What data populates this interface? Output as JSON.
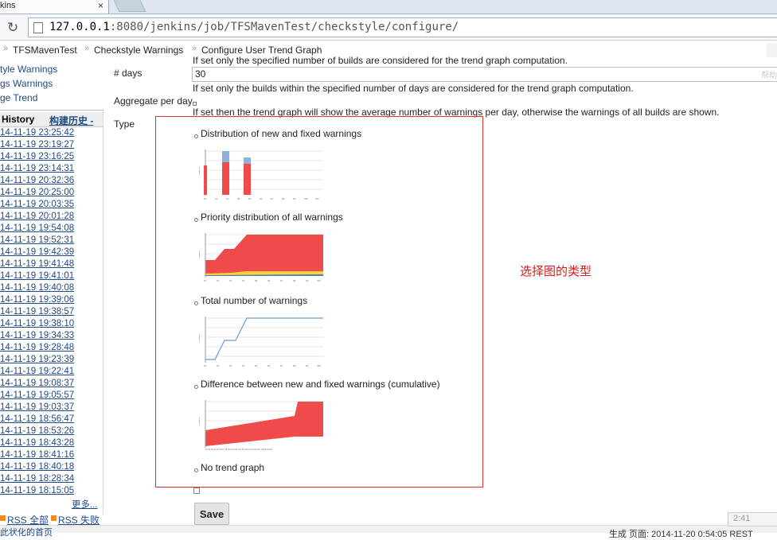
{
  "browser": {
    "tab_title": "kins",
    "tab_close": "×",
    "url_host": "127.0.0.1",
    "url_rest": ":8080/jenkins/job/TFSMavenTest/checkstyle/configure/"
  },
  "breadcrumb": [
    "TFSMavenTest",
    "Checkstyle Warnings",
    "Configure User Trend Graph"
  ],
  "sidebar": {
    "links": [
      "tyle Warnings",
      "gs Warnings",
      "ge Trend"
    ],
    "history_title": "History",
    "history_cn": "构建历史 -",
    "history_rows": [
      "14-11-19 23:25:42",
      "14-11-19 23:19:27",
      "14-11-19 23:16:25",
      "14-11-19 23:14:31",
      "14-11-19 20:32:36",
      "14-11-19 20:25:00",
      "14-11-19 20:03:35",
      "14-11-19 20:01:28",
      "14-11-19 19:54:08",
      "14-11-19 19:52:31",
      "14-11-19 19:42:39",
      "14-11-19 19:41:48",
      "14-11-19 19:41:01",
      "14-11-19 19:40:08",
      "14-11-19 19:39:06",
      "14-11-19 19:38:57",
      "14-11-19 19:38:10",
      "14-11-19 19:34:33",
      "14-11-19 19:28:48",
      "14-11-19 19:23:39",
      "14-11-19 19:22:41",
      "14-11-19 19:08:37",
      "14-11-19 19:05:57",
      "14-11-19 19:03:37",
      "14-11-19 18:56:47",
      "14-11-19 18:53:26",
      "14-11-19 18:43:28",
      "14-11-19 18:41:16",
      "14-11-19 18:40:18",
      "14-11-19 18:28:34",
      "14-11-19 18:15:05"
    ],
    "more": "更多...",
    "rss_all": "RSS 全部",
    "rss_fail": "RSS 失败",
    "bottom_left": "此状化的首页"
  },
  "form": {
    "cut_help": "If set only the specified number of builds are considered for the trend graph computation.",
    "days_label": "# days",
    "days_value": "30",
    "days_help": "If set only the builds within the specified number of days are considered for the trend graph computation.",
    "aggregate_label": "Aggregate per day",
    "aggregate_help": "If set then the trend graph will show the average number of warnings per day, otherwise the warnings of all builds are shown.",
    "type_label": "Type",
    "options": [
      "Distribution of new and fixed warnings",
      "Priority distribution of all warnings",
      "Total number of warnings",
      "Difference between new and fixed warnings (cumulative)",
      "No trend graph"
    ],
    "save_label": "Save"
  },
  "annotation": "选择图的类型",
  "footer": "生成 页面: 2014-11-20 0:54:05 REST",
  "clock": "2:41",
  "ghost": "帮助"
}
